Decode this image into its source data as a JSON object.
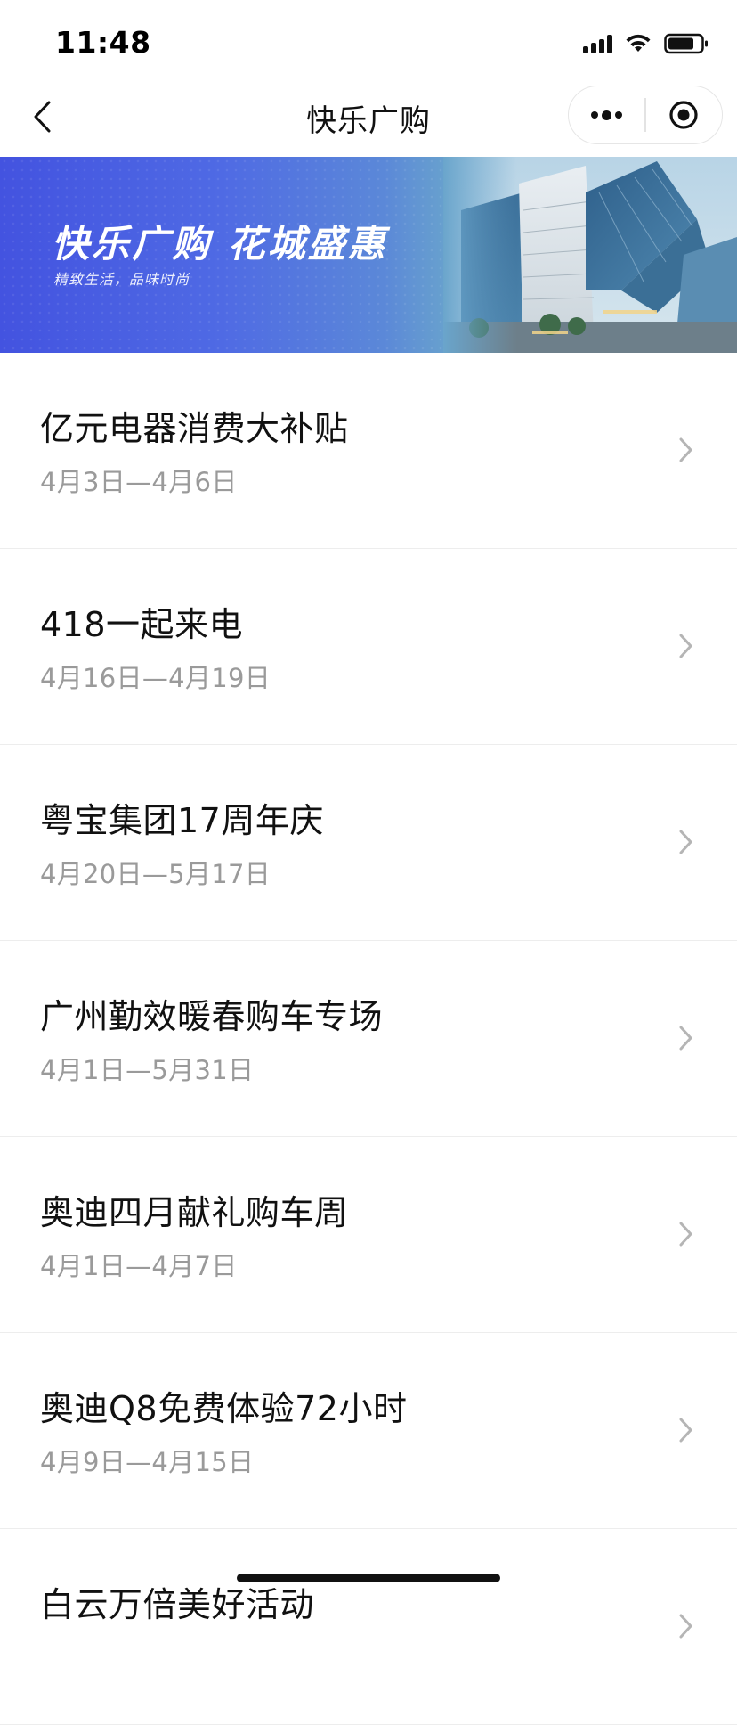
{
  "status_bar": {
    "time": "11:48"
  },
  "nav": {
    "title": "快乐广购"
  },
  "banner": {
    "title": "快乐广购 花城盛惠",
    "subtitle": "精致生活，品味时尚"
  },
  "events": [
    {
      "title": "亿元电器消费大补贴",
      "date": "4月3日—4月6日"
    },
    {
      "title": "418一起来电",
      "date": "4月16日—4月19日"
    },
    {
      "title": "粤宝集团17周年庆",
      "date": "4月20日—5月17日"
    },
    {
      "title": "广州勤效暖春购车专场",
      "date": "4月1日—5月31日"
    },
    {
      "title": "奥迪四月献礼购车周",
      "date": "4月1日—4月7日"
    },
    {
      "title": "奥迪Q8免费体验72小时",
      "date": "4月9日—4月15日"
    },
    {
      "title": "白云万倍美好活动",
      "date": ""
    }
  ],
  "colors": {
    "accent": "#4353e0",
    "text_primary": "#111111",
    "text_secondary": "#9a9a9a",
    "divider": "#ededed"
  },
  "icons": {
    "back": "chevron-left-icon",
    "more": "more-dots-icon",
    "close": "target-icon",
    "row": "chevron-right-icon"
  }
}
